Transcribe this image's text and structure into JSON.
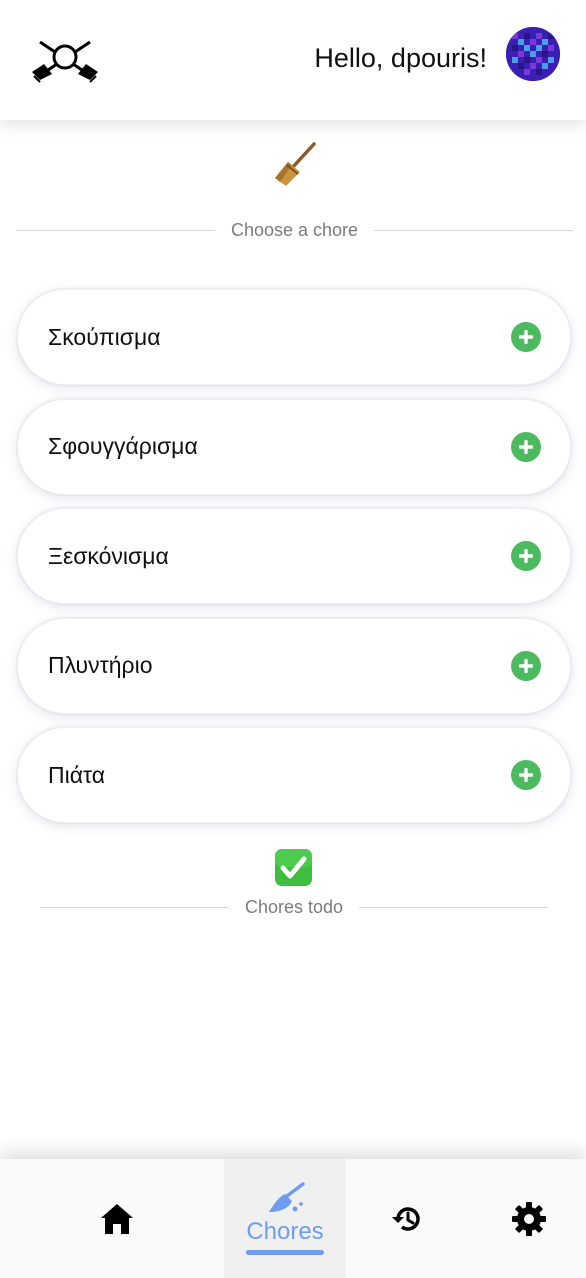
{
  "header": {
    "greeting": "Hello, dpouris!",
    "logo_icon": "crossed-brooms-icon",
    "avatar": "pixel-avatar"
  },
  "choose_section": {
    "emoji": "broom-emoji",
    "label": "Choose a chore"
  },
  "chores": [
    {
      "label": "Σκούπισμα"
    },
    {
      "label": "Σφουγγάρισμα"
    },
    {
      "label": "Ξεσκόνισμα"
    },
    {
      "label": "Πλυντήριο"
    },
    {
      "label": "Πιάτα"
    }
  ],
  "todo_section": {
    "emoji": "check-mark-emoji",
    "label": "Chores todo"
  },
  "bottom_nav": {
    "items": [
      {
        "icon": "home-icon",
        "label": ""
      },
      {
        "icon": "broom-icon",
        "label": "Chores",
        "active": true
      },
      {
        "icon": "history-icon",
        "label": ""
      },
      {
        "icon": "gear-icon",
        "label": ""
      }
    ]
  },
  "colors": {
    "accent": "#6e9cf0",
    "add_green": "#4cba5e",
    "divider": "#d7d7d7"
  }
}
